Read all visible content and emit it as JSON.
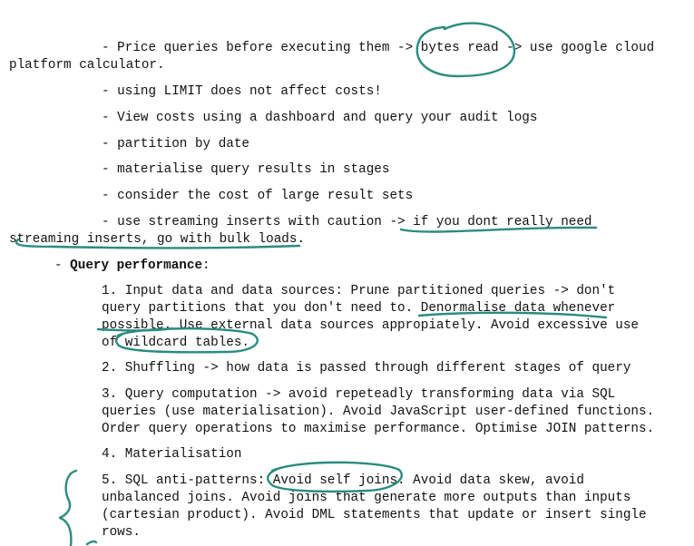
{
  "cost_tips": [
    "- Price queries before executing them -> bytes read -> use google cloud",
    "platform calculator.",
    "- using LIMIT does not affect costs!",
    "- View costs using a dashboard and query your audit logs",
    "- partition by date",
    "- materialise query results in stages",
    "- consider the cost of large result sets",
    "- use streaming inserts with caution -> if you dont really need",
    "streaming inserts, go with bulk loads."
  ],
  "performance": {
    "bullet": "- ",
    "heading": "Query performance",
    "colon": ":",
    "items": [
      [
        "1. Input data and data sources: Prune partitioned queries -> don't",
        "query partitions that you don't need to. Denormalise data whenever",
        "possible. Use external data sources appropiately. Avoid excessive use",
        "of wildcard tables."
      ],
      [
        "2. Shuffling -> how data is passed through different stages of query"
      ],
      [
        "3. Query computation -> avoid repeteadly transforming data via SQL",
        "queries (use materialisation). Avoid JavaScript user-defined functions.",
        "Order query operations to maximise performance. Optimise JOIN patterns."
      ],
      [
        "4. Materialisation"
      ],
      [
        "5. SQL anti-patterns: Avoid self joins. Avoid data skew, avoid",
        "unbalanced joins. Avoid joins that generate more outputs than inputs",
        "(cartesian product). Avoid DML statements that update or insert single",
        "rows."
      ]
    ]
  },
  "colors": {
    "ink": "#2a8c7e",
    "text": "#111111"
  }
}
